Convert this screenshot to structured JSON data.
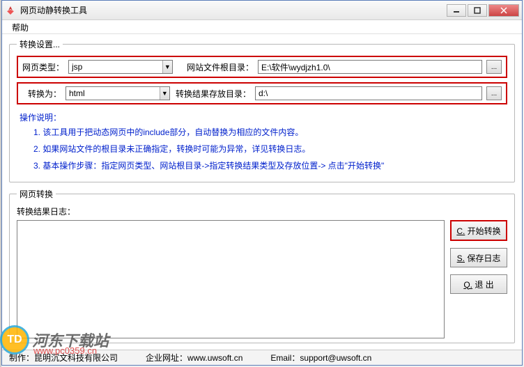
{
  "window": {
    "title": "网页动静转换工具"
  },
  "menubar": {
    "help": "帮助"
  },
  "settings": {
    "legend": "转换设置...",
    "page_type_label": "网页类型：",
    "page_type_value": "jsp",
    "root_dir_label": "网站文件根目录：",
    "root_dir_value": "E:\\软件\\wydjzh1.0\\",
    "convert_to_label": "转换为：",
    "convert_to_value": "html",
    "result_dir_label": "转换结果存放目录：",
    "result_dir_value": "d:\\",
    "browse_ellipsis": "..."
  },
  "instructions": {
    "header": "操作说明：",
    "items": [
      "1. 该工具用于把动态网页中的include部分，自动替换为相应的文件内容。",
      "2. 如果网站文件的根目录未正确指定，转换时可能为异常，详见转换日志。",
      "3. 基本操作步骤：指定网页类型、网站根目录->指定转换结果类型及存放位置-> 点击\"开始转换\""
    ]
  },
  "convert": {
    "legend": "网页转换",
    "log_label": "转换结果日志：",
    "start_prefix": "C.",
    "start_label": " 开始转换",
    "save_prefix": "S.",
    "save_label": " 保存日志",
    "quit_prefix": "Q.",
    "quit_label": " 退  出"
  },
  "statusbar": {
    "maker": "制作：昆明沉文科技有限公司",
    "site_label": "企业网址：",
    "site_value": "www.uwsoft.cn",
    "email_label": "Email：",
    "email_value": "support@uwsoft.cn"
  },
  "watermark": {
    "logo_text": "TD",
    "brand": "河东下载站",
    "url": "www.pc0359.cn"
  }
}
